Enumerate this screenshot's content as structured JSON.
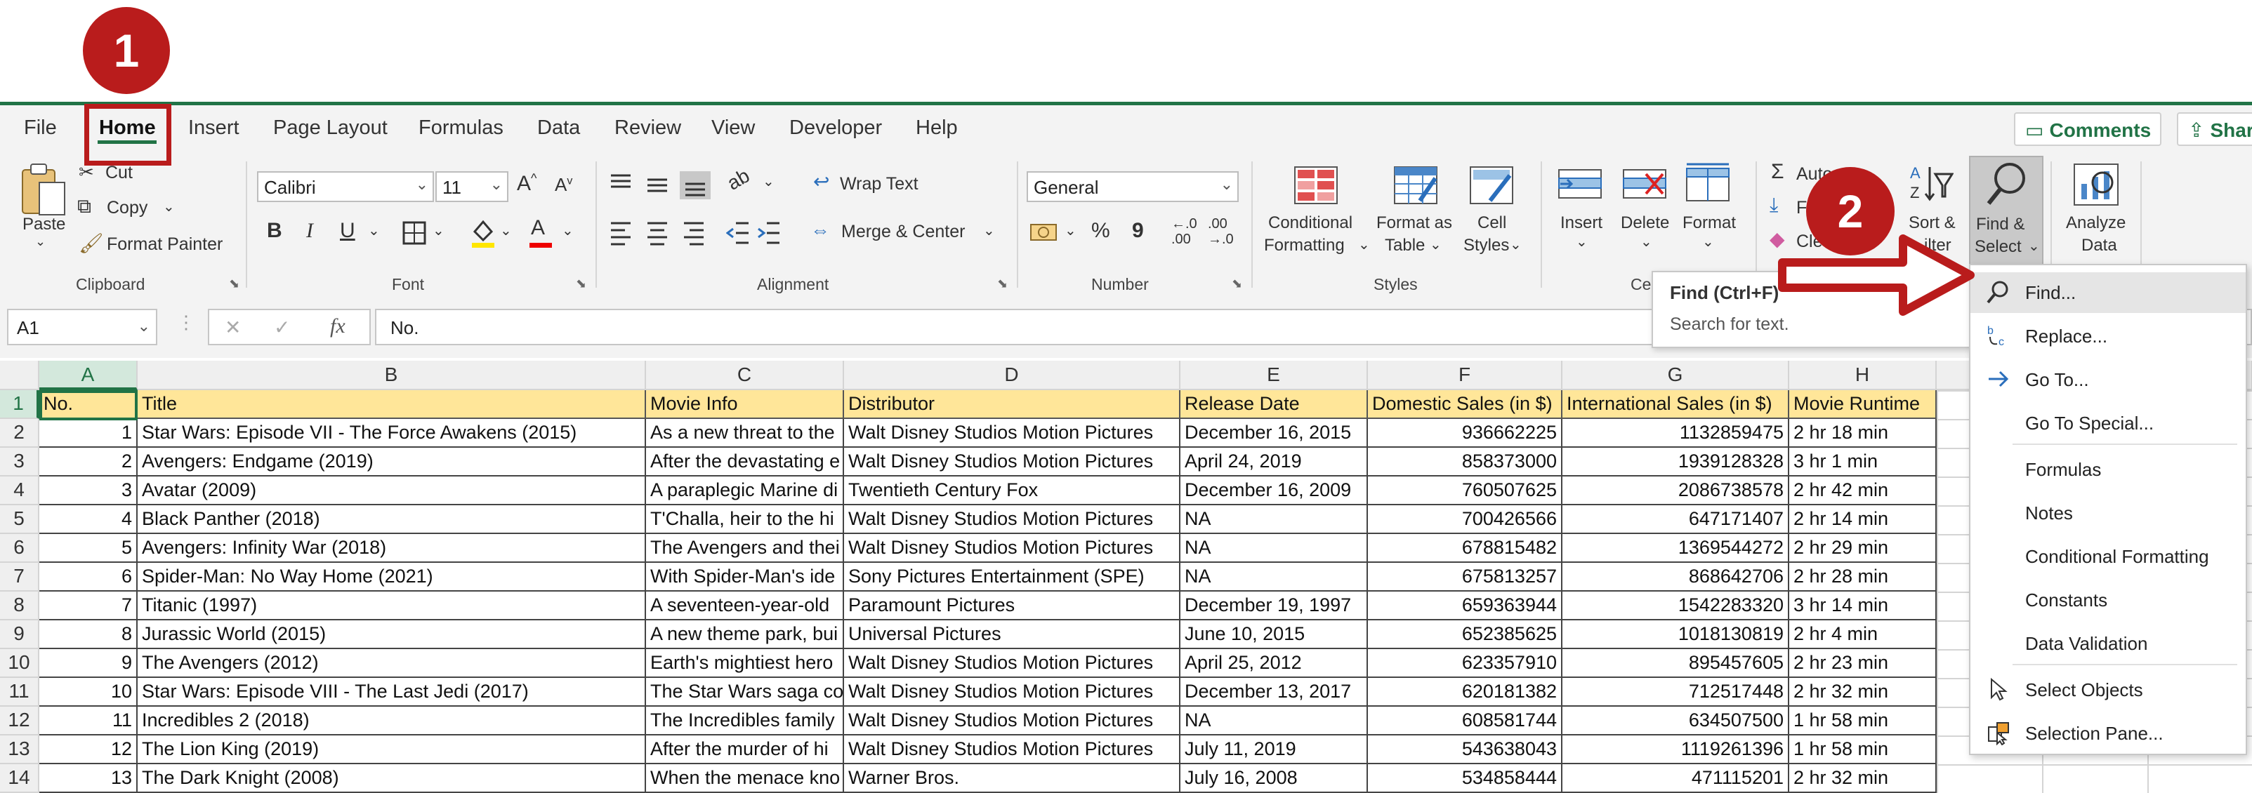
{
  "tabs": [
    "File",
    "Home",
    "Insert",
    "Page Layout",
    "Formulas",
    "Data",
    "Review",
    "View",
    "Developer",
    "Help"
  ],
  "active_tab": "Home",
  "top_buttons": {
    "comments": "Comments",
    "share": "Shar"
  },
  "clipboard": {
    "paste": "Paste",
    "cut": "Cut",
    "copy": "Copy",
    "format_painter": "Format Painter",
    "group": "Clipboard"
  },
  "font": {
    "name": "Calibri",
    "size": "11",
    "bold": "B",
    "italic": "I",
    "underline": "U",
    "grow": "A",
    "shrink": "A",
    "font_color_letter": "A",
    "group": "Font"
  },
  "alignment": {
    "wrap_text": "Wrap Text",
    "merge_center": "Merge & Center",
    "group": "Alignment"
  },
  "number": {
    "format": "General",
    "percent": "%",
    "comma": "9",
    "inc_decimal": "←.0\n.00",
    "dec_decimal": ".00\n→.0",
    "group": "Number"
  },
  "styles": {
    "conditional_1": "Conditional",
    "conditional_2": "Formatting",
    "format_table_1": "Format as",
    "format_table_2": "Table",
    "cell_styles_1": "Cell",
    "cell_styles_2": "Styles",
    "group": "Styles"
  },
  "cells": {
    "insert": "Insert",
    "delete": "Delete",
    "format": "Format",
    "group": "Cell"
  },
  "editing": {
    "autosum": "Auto",
    "fill": "F",
    "clear": "Cle",
    "sort_1": "Sort &",
    "sort_2": "ilter",
    "find_1": "Find &",
    "find_2": "Select"
  },
  "analysis": {
    "analyze_1": "Analyze",
    "analyze_2": "Data"
  },
  "formula_bar": {
    "name_box": "A1",
    "fx": "fx",
    "cancel": "✕",
    "enter": "✓",
    "content": "No."
  },
  "columns": [
    "A",
    "B",
    "C",
    "D",
    "E",
    "F",
    "G",
    "H"
  ],
  "table": {
    "headers": [
      "No.",
      "Title",
      "Movie Info",
      "Distributor",
      "Release Date",
      "Domestic Sales (in $)",
      "International Sales (in $)",
      "Movie Runtime"
    ],
    "rows": [
      [
        "1",
        "Star Wars: Episode VII - The Force Awakens (2015)",
        "As a new threat to the",
        "Walt Disney Studios Motion Pictures",
        "December 16, 2015",
        "936662225",
        "1132859475",
        "2 hr 18 min"
      ],
      [
        "2",
        "Avengers: Endgame (2019)",
        "After the devastating e",
        "Walt Disney Studios Motion Pictures",
        "April 24, 2019",
        "858373000",
        "1939128328",
        "3 hr 1 min"
      ],
      [
        "3",
        "Avatar (2009)",
        "A paraplegic Marine di",
        "Twentieth Century Fox",
        "December 16, 2009",
        "760507625",
        "2086738578",
        "2 hr 42 min"
      ],
      [
        "4",
        "Black Panther (2018)",
        "T'Challa, heir to the hi",
        "Walt Disney Studios Motion Pictures",
        "NA",
        "700426566",
        "647171407",
        "2 hr 14 min"
      ],
      [
        "5",
        "Avengers: Infinity War (2018)",
        "The Avengers and thei",
        "Walt Disney Studios Motion Pictures",
        "NA",
        "678815482",
        "1369544272",
        "2 hr 29 min"
      ],
      [
        "6",
        "Spider-Man: No Way Home (2021)",
        "With Spider-Man's ide",
        "Sony Pictures Entertainment (SPE)",
        "NA",
        "675813257",
        "868642706",
        "2 hr 28 min"
      ],
      [
        "7",
        "Titanic (1997)",
        "A seventeen-year-old",
        "Paramount Pictures",
        "December 19, 1997",
        "659363944",
        "1542283320",
        "3 hr 14 min"
      ],
      [
        "8",
        "Jurassic World (2015)",
        "A new theme park, bui",
        "Universal Pictures",
        "June 10, 2015",
        "652385625",
        "1018130819",
        "2 hr 4 min"
      ],
      [
        "9",
        "The Avengers (2012)",
        "Earth's mightiest hero",
        "Walt Disney Studios Motion Pictures",
        "April 25, 2012",
        "623357910",
        "895457605",
        "2 hr 23 min"
      ],
      [
        "10",
        "Star Wars: Episode VIII - The Last Jedi (2017)",
        "The Star Wars saga co",
        "Walt Disney Studios Motion Pictures",
        "December 13, 2017",
        "620181382",
        "712517448",
        "2 hr 32 min"
      ],
      [
        "11",
        "Incredibles 2 (2018)",
        "The Incredibles family",
        "Walt Disney Studios Motion Pictures",
        "NA",
        "608581744",
        "634507500",
        "1 hr 58 min"
      ],
      [
        "12",
        "The Lion King (2019)",
        "After the murder of hi",
        "Walt Disney Studios Motion Pictures",
        "July 11, 2019",
        "543638043",
        "1119261396",
        "1 hr 58 min"
      ],
      [
        "13",
        "The Dark Knight (2008)",
        "When the menace kno",
        "Warner Bros.",
        "July 16, 2008",
        "534858444",
        "471115201",
        "2 hr 32 min"
      ]
    ]
  },
  "row_numbers": [
    "1",
    "2",
    "3",
    "4",
    "5",
    "6",
    "7",
    "8",
    "9",
    "10",
    "11",
    "12",
    "13",
    "14"
  ],
  "tooltip": {
    "title": "Find (Ctrl+F)",
    "desc": "Search for text."
  },
  "find_menu": {
    "items": [
      "Find...",
      "Replace...",
      "Go To...",
      "Go To Special...",
      "Formulas",
      "Notes",
      "Conditional Formatting",
      "Constants",
      "Data Validation",
      "Select Objects",
      "Selection Pane..."
    ],
    "icons": [
      "search-icon",
      "replace-icon",
      "arrow-right-icon",
      "",
      "",
      "",
      "",
      "",
      "",
      "cursor-arrow-icon",
      "selection-pane-icon"
    ]
  },
  "annotations": {
    "step1": "1",
    "step2": "2"
  },
  "colors": {
    "excel_green": "#217346",
    "annotation_red": "#b91c1c",
    "header_fill": "#ffe699"
  }
}
